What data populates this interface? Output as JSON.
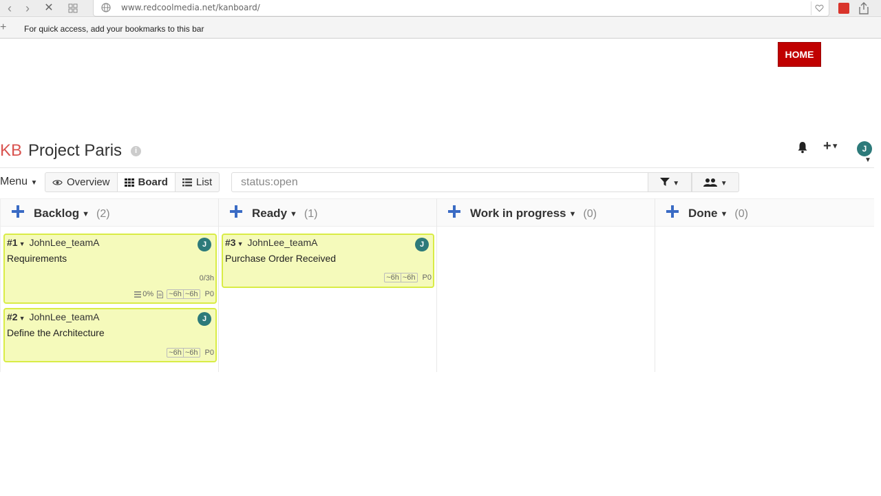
{
  "browser": {
    "url": "www.redcoolmedia.net/kanboard/",
    "bookmarks_hint": "For quick access, add your bookmarks to this bar"
  },
  "home_button": "HOME",
  "project": {
    "logo": "KB",
    "name": "Project Paris",
    "user_initial": "J"
  },
  "toolbar": {
    "menu_label": "Menu",
    "views": [
      {
        "label": "Overview",
        "icon": "eye-icon",
        "active": false
      },
      {
        "label": "Board",
        "icon": "grid-icon",
        "active": true
      },
      {
        "label": "List",
        "icon": "list-icon",
        "active": false
      }
    ],
    "search_value": "status:open"
  },
  "columns": [
    {
      "title": "Backlog",
      "count": "(2)",
      "cards": [
        {
          "id": "#1",
          "owner": "JohnLee_teamA",
          "title": "Requirements",
          "avatar": "J",
          "time_spent": "0/3h",
          "progress": "0%",
          "estimate_a": "~6h",
          "estimate_b": "~6h",
          "priority": "P0"
        },
        {
          "id": "#2",
          "owner": "JohnLee_teamA",
          "title": "Define the Architecture",
          "avatar": "J",
          "estimate_a": "~6h",
          "estimate_b": "~6h",
          "priority": "P0"
        }
      ]
    },
    {
      "title": "Ready",
      "count": "(1)",
      "cards": [
        {
          "id": "#3",
          "owner": "JohnLee_teamA",
          "title": "Purchase Order Received",
          "avatar": "J",
          "estimate_a": "~6h",
          "estimate_b": "~6h",
          "priority": "P0"
        }
      ]
    },
    {
      "title": "Work in progress",
      "count": "(0)",
      "cards": []
    },
    {
      "title": "Done",
      "count": "(0)",
      "cards": []
    }
  ],
  "colors": {
    "accent_red": "#c00000",
    "plus_blue": "#3a6bc4",
    "card_bg": "#f5fabb",
    "card_border": "#d9ec45",
    "avatar_teal": "#2d7a7a"
  }
}
